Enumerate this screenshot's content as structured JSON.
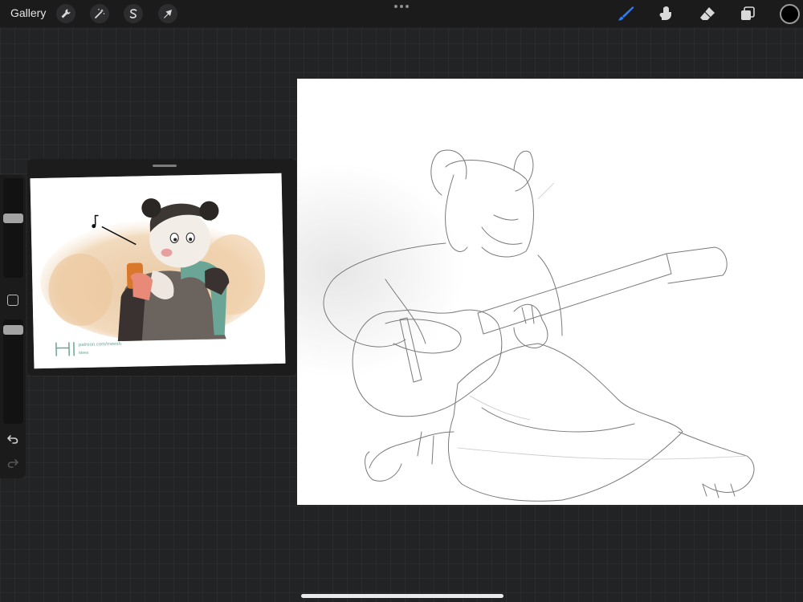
{
  "topbar": {
    "gallery_label": "Gallery",
    "left_tools": [
      {
        "name": "actions",
        "icon": "wrench-icon"
      },
      {
        "name": "adjustments",
        "icon": "magic-wand-icon"
      },
      {
        "name": "selection",
        "icon": "selection-s-icon"
      },
      {
        "name": "transform",
        "icon": "arrow-cursor-icon"
      }
    ],
    "right_tools": [
      {
        "name": "brush",
        "icon": "brush-icon",
        "active": true
      },
      {
        "name": "smudge",
        "icon": "smudge-icon",
        "active": false
      },
      {
        "name": "eraser",
        "icon": "eraser-icon",
        "active": false
      },
      {
        "name": "layers",
        "icon": "layers-icon",
        "active": false
      }
    ],
    "current_color": "#000000",
    "accent_color": "#2f7cf6"
  },
  "sidebar": {
    "brush_size_level": 0.5,
    "opacity_level": 0.25,
    "modify_button": "square-icon",
    "undo": "undo-icon",
    "redo": "redo-icon"
  },
  "reference": {
    "watermark_text": "patreon.com/meesh",
    "watermark_sub": "Mees"
  },
  "canvas": {
    "background": "#ffffff"
  }
}
